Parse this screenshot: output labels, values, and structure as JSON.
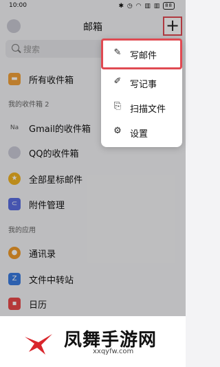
{
  "status": {
    "time": "10:00",
    "icons": "✱ ◷ ◠ ▥ ▥",
    "battery": "88"
  },
  "header": {
    "title": "邮箱",
    "add_label": "+"
  },
  "search": {
    "placeholder": "搜索"
  },
  "list": {
    "all_inbox": "所有收件箱",
    "section_mine": "我的收件箱 2",
    "gmail_badge": "Na",
    "gmail": "Gmail的收件箱",
    "qq": "QQ的收件箱",
    "starred": "全部星标邮件",
    "attachments": "附件管理",
    "section_apps": "我的应用",
    "contacts": "通讯录",
    "transfer": "文件中转站",
    "calendar": "日历"
  },
  "menu": {
    "compose": "写邮件",
    "note": "写记事",
    "scan": "扫描文件",
    "settings": "设置"
  },
  "colors": {
    "highlight": "#e04a52",
    "inbox": "#f1a13a",
    "qq": "#c9c9d6",
    "star": "#f0b323",
    "attach": "#5a6ee0",
    "contacts": "#f09a2a",
    "transfer": "#3a7be0",
    "calendar": "#e84a4a"
  },
  "watermark": {
    "text": "凤舞手游网",
    "url": "xxqyfw.com"
  }
}
